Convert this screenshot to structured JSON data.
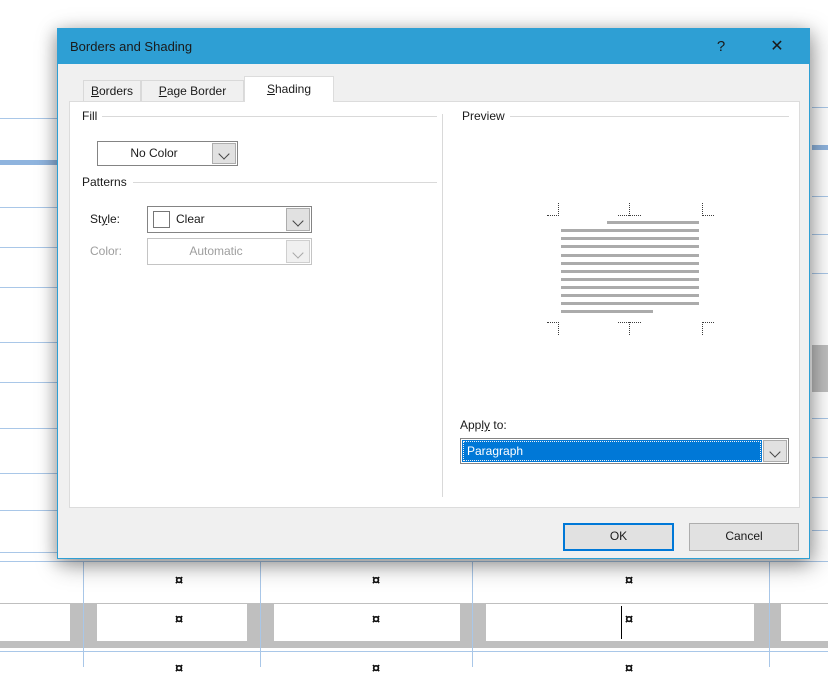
{
  "dialog": {
    "title": "Borders and Shading",
    "window_controls": {
      "help": "?",
      "close": "✕"
    },
    "tabs": [
      {
        "pre": "",
        "key": "B",
        "post": "orders"
      },
      {
        "pre": "",
        "key": "P",
        "post": "age Border"
      },
      {
        "pre": "",
        "key": "S",
        "post": "hading"
      }
    ],
    "active_tab": "Shading",
    "fill_group": {
      "label": "Fill",
      "combo_value": "No Color"
    },
    "patterns_group": {
      "label": "Patterns",
      "style_label": {
        "pre": "St",
        "key": "y",
        "post": "le:"
      },
      "style_value": "Clear",
      "style_swatch": "clear-white-swatch",
      "color_label": "Color:",
      "color_value": "Automatic",
      "color_enabled": false
    },
    "preview_group": {
      "label": "Preview"
    },
    "apply_to": {
      "label": {
        "pre": "App",
        "key": "ly",
        "post": " to:"
      },
      "value": "Paragraph",
      "selected": true
    },
    "buttons": {
      "ok": "OK",
      "cancel": "Cancel"
    }
  },
  "background": {
    "cell_marker": "¤",
    "description": "Word document table with formatting marks, one row shaded gray, text caret in third cell"
  },
  "colors": {
    "titlebar": "#2e9fd4",
    "selection_blue": "#0078d7",
    "default_button_border": "#0078d7",
    "table_line_blue": "#a9c7e8",
    "row_shading_gray": "#bfbfbf",
    "preview_bar_gray": "#ababab",
    "dialog_body": "#f0f0f0"
  }
}
